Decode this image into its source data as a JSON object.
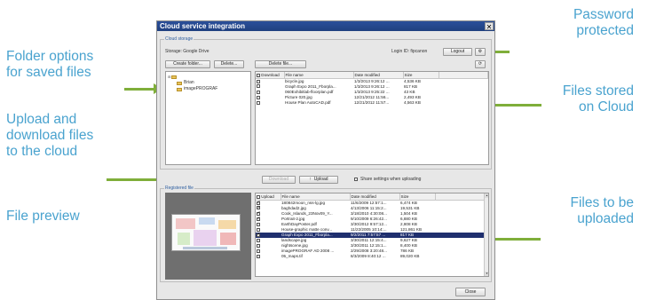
{
  "callouts": {
    "folder_options": [
      "Folder options",
      "for saved files"
    ],
    "upload_download": [
      "Upload and",
      "download files",
      "to the cloud"
    ],
    "file_preview": [
      "File preview"
    ],
    "password": [
      "Password",
      "protected"
    ],
    "files_stored": [
      "Files stored",
      "on Cloud"
    ],
    "files_upload": [
      "Files to be",
      "uploaded"
    ]
  },
  "dialog": {
    "title": "Cloud service integration",
    "close_glyph": "✕",
    "cloud_group_label": "Cloud storage",
    "storage_label": "Storage: Google Drive",
    "login_label": "Login ID: fipcanon",
    "logout_button": "Logout",
    "gear_glyph": "⚙",
    "refresh_glyph": "⟳",
    "create_folder_button": "Create folder...",
    "delete_button": "Delete...",
    "delete_file_button": "Delete file...",
    "tree": [
      "Brian",
      "imagePROGRAF"
    ],
    "cloud_columns": [
      "Download",
      "File name",
      "Date modified",
      "Size"
    ],
    "cloud_files": [
      {
        "name": "bicycle.jpg",
        "date": "1/3/2013 9:26:12 ...",
        "size": "4,536 KB"
      },
      {
        "name": "Graph Expo 2011_Fborpla...",
        "date": "1/3/2013 9:26:12 ...",
        "size": "817 KB"
      },
      {
        "name": "060Exhibitlab-floorplan.pdf",
        "date": "1/3/2013 9:25:22 ...",
        "size": "43 KB"
      },
      {
        "name": "Picture 020.jpg",
        "date": "12/21/2012 11:56...",
        "size": "2,493 KB"
      },
      {
        "name": "House Plan AutoCAD.pdf",
        "date": "12/21/2012 11:57...",
        "size": "4,563 KB"
      }
    ],
    "download_button": "Download",
    "upload_arrow": "↑",
    "upload_button": "Upload",
    "share_label": "Share settings when uploading",
    "registered_group_label": "Registered file",
    "registered_columns": [
      "Upload",
      "File name",
      "Date modified",
      "Size"
    ],
    "registered_files": [
      {
        "checked": true,
        "selected": false,
        "name": "180842moon_nss-lg.jpg",
        "date": "11/6/2009 12:57:1...",
        "size": "6,474 KB"
      },
      {
        "checked": true,
        "selected": false,
        "name": "baghdad2.jpg",
        "date": "4/13/2006 11:15:2...",
        "size": "19,531 KB"
      },
      {
        "checked": true,
        "selected": false,
        "name": "Cook_Islands_23Nov09_Y...",
        "date": "3/18/2010 4:30:08...",
        "size": "1,504 KB"
      },
      {
        "checked": true,
        "selected": false,
        "name": "Portrait-2.jpg",
        "date": "9/10/2009 6:26:42...",
        "size": "6,880 KB"
      },
      {
        "checked": false,
        "selected": false,
        "name": "EarthDayPoster.pdf",
        "date": "3/30/2012 9:57:12...",
        "size": "2,808 KB"
      },
      {
        "checked": false,
        "selected": false,
        "name": "House-graphic matte conv...",
        "date": "11/22/2005 10:14:...",
        "size": "121,861 KB"
      },
      {
        "checked": true,
        "selected": true,
        "name": "Graph Expo 2011_Fborpla...",
        "date": "9/2/2011 7:57:57 ...",
        "size": "817 KB"
      },
      {
        "checked": false,
        "selected": false,
        "name": "landscape.jpg",
        "date": "3/30/2011 12:15:4...",
        "size": "9,627 KB"
      },
      {
        "checked": false,
        "selected": false,
        "name": "nightscene.jpg",
        "date": "3/30/2011 12:15:1...",
        "size": "8,400 KB"
      },
      {
        "checked": false,
        "selected": false,
        "name": "imagePROGRAF AD 2008 ...",
        "date": "2/29/2008 3:20:48...",
        "size": "786 KB"
      },
      {
        "checked": false,
        "selected": false,
        "name": "05_maps.tif",
        "date": "8/3/2009 8:40:12 ...",
        "size": "89,020 KB"
      }
    ],
    "close_button": "Close"
  },
  "colors": {
    "callout_text": "#4aa3cf",
    "arrow": "#7fae3a",
    "titlebar": "#2a4f9a",
    "selected_row": "#1f2f6e"
  }
}
